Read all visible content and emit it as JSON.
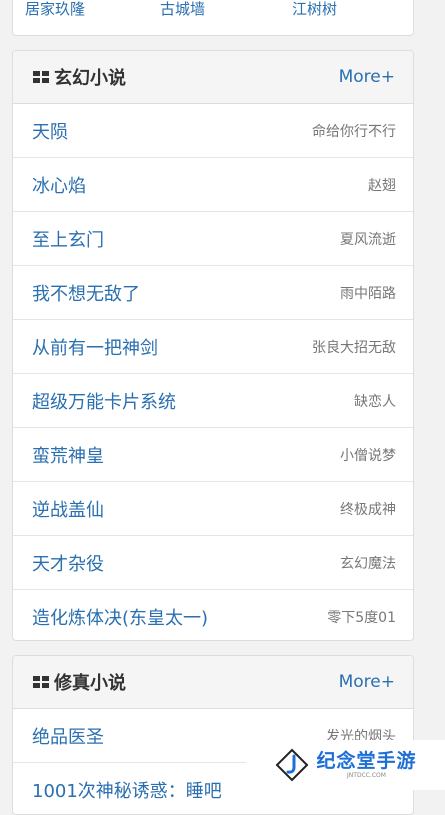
{
  "top_links": [
    "居家玖隆",
    "古城墙",
    "江树树"
  ],
  "sections": [
    {
      "title": "玄幻小说",
      "more_label": "More+",
      "books": [
        {
          "title": "天陨",
          "author": "命给你行不行"
        },
        {
          "title": "冰心焰",
          "author": "赵翅"
        },
        {
          "title": "至上玄门",
          "author": "夏风流逝"
        },
        {
          "title": "我不想无敌了",
          "author": "雨中陌路"
        },
        {
          "title": "从前有一把神剑",
          "author": "张良大招无敌"
        },
        {
          "title": "超级万能卡片系统",
          "author": "缺恋人"
        },
        {
          "title": "蛮荒神皇",
          "author": "小僧说梦"
        },
        {
          "title": "逆战盖仙",
          "author": "终极成神"
        },
        {
          "title": "天才杂役",
          "author": "玄幻魔法"
        },
        {
          "title": "造化炼体决(东皇太一)",
          "author": "零下5度01"
        }
      ]
    },
    {
      "title": "修真小说",
      "more_label": "More+",
      "books": [
        {
          "title": "绝品医圣",
          "author": "发光的烟头"
        },
        {
          "title": "1001次神秘诱惑：睡吧",
          "author": ""
        }
      ]
    }
  ],
  "watermark": {
    "brand": "纪念堂手游",
    "site": "JNTDCC.COM"
  },
  "colors": {
    "link": "#2a6fb0",
    "header_bg": "#f5f5f5",
    "border": "#dddddd",
    "brand": "#1d6fd6"
  }
}
